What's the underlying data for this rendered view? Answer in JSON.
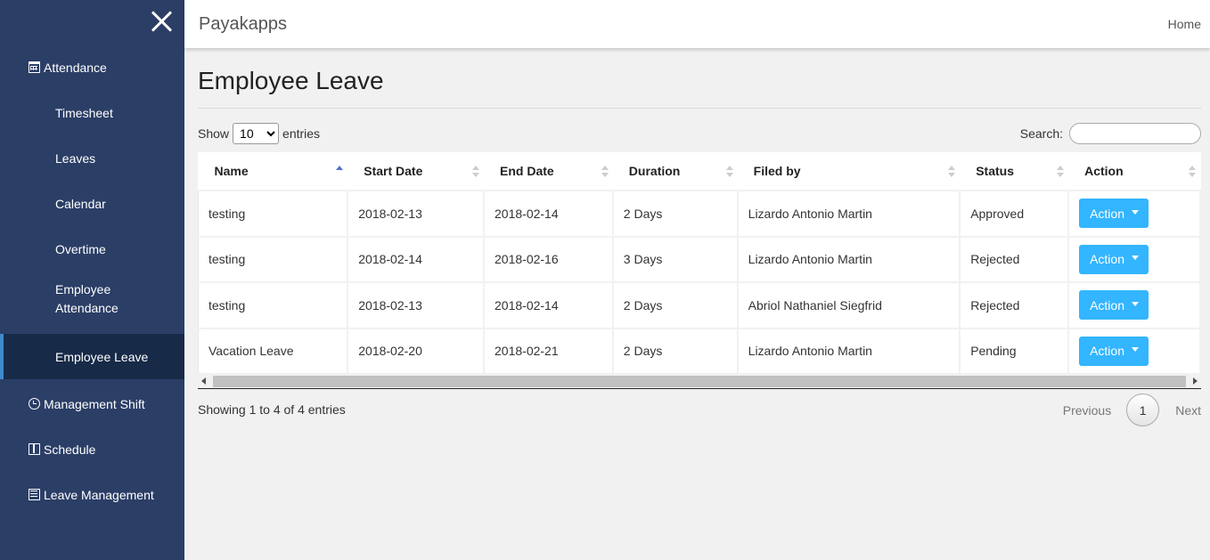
{
  "app": {
    "brand": "Payakapps",
    "home_link": "Home"
  },
  "sidebar": {
    "items": [
      {
        "label": "Attendance",
        "icon": "calendar-icon"
      },
      {
        "label": "Timesheet"
      },
      {
        "label": "Leaves"
      },
      {
        "label": "Calendar"
      },
      {
        "label": "Overtime"
      },
      {
        "label": "Employee Attendance",
        "line1": "Employee",
        "line2": "Attendance"
      },
      {
        "label": "Employee Leave",
        "active": true
      },
      {
        "label": "Management Shift",
        "icon": "clock-icon"
      },
      {
        "label": "Schedule",
        "icon": "schedule-icon"
      },
      {
        "label": "Leave Management",
        "icon": "list-icon"
      }
    ]
  },
  "main": {
    "title": "Employee Leave",
    "show_label": "Show",
    "entries_label": "entries",
    "page_length": "10",
    "search_label": "Search:",
    "search_value": "",
    "columns": [
      "Name",
      "Start Date",
      "End Date",
      "Duration",
      "Filed by",
      "Status",
      "Action"
    ],
    "rows": [
      {
        "name": "testing",
        "start": "2018-02-13",
        "end": "2018-02-14",
        "duration": "2 Days",
        "filed_by": "Lizardo Antonio Martin",
        "status": "Approved",
        "action": "Action"
      },
      {
        "name": "testing",
        "start": "2018-02-14",
        "end": "2018-02-16",
        "duration": "3 Days",
        "filed_by": "Lizardo Antonio Martin",
        "status": "Rejected",
        "action": "Action"
      },
      {
        "name": "testing",
        "start": "2018-02-13",
        "end": "2018-02-14",
        "duration": "2 Days",
        "filed_by": "Abriol Nathaniel Siegfrid",
        "status": "Rejected",
        "action": "Action"
      },
      {
        "name": "Vacation Leave",
        "start": "2018-02-20",
        "end": "2018-02-21",
        "duration": "2 Days",
        "filed_by": "Lizardo Antonio Martin",
        "status": "Pending",
        "action": "Action"
      }
    ],
    "info": "Showing 1 to 4 of 4 entries",
    "pagination": {
      "previous": "Previous",
      "current": "1",
      "next": "Next"
    }
  },
  "colors": {
    "sidebar_bg": "#2b3e66",
    "sidebar_active_bg": "#172a48",
    "accent": "#33b5ff",
    "sort_active": "#5470d6"
  }
}
